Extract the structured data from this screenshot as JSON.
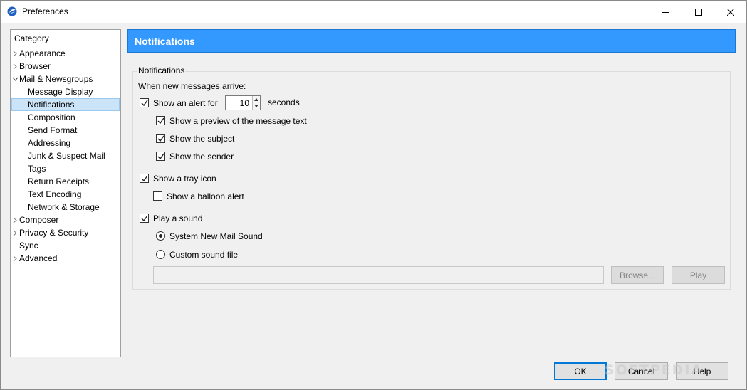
{
  "window": {
    "title": "Preferences"
  },
  "category": {
    "header": "Category",
    "items": [
      {
        "label": "Appearance"
      },
      {
        "label": "Browser"
      },
      {
        "label": "Mail & Newsgroups"
      },
      {
        "label": "Message Display"
      },
      {
        "label": "Notifications"
      },
      {
        "label": "Composition"
      },
      {
        "label": "Send Format"
      },
      {
        "label": "Addressing"
      },
      {
        "label": "Junk & Suspect Mail"
      },
      {
        "label": "Tags"
      },
      {
        "label": "Return Receipts"
      },
      {
        "label": "Text Encoding"
      },
      {
        "label": "Network & Storage"
      },
      {
        "label": "Composer"
      },
      {
        "label": "Privacy & Security"
      },
      {
        "label": "Sync"
      },
      {
        "label": "Advanced"
      }
    ]
  },
  "panel": {
    "title": "Notifications",
    "group_title": "Notifications",
    "intro": "When new messages arrive:",
    "alert_label": "Show an alert for",
    "alert_seconds": "10",
    "seconds_label": "seconds",
    "preview_label": "Show a preview of the message text",
    "subject_label": "Show the subject",
    "sender_label": "Show the sender",
    "tray_label": "Show a tray icon",
    "balloon_label": "Show a balloon alert",
    "sound_label": "Play a sound",
    "system_sound_label": "System New Mail Sound",
    "custom_sound_label": "Custom sound file",
    "browse_label": "Browse...",
    "play_label": "Play"
  },
  "states": {
    "show_alert": true,
    "show_preview": true,
    "show_subject": true,
    "show_sender": true,
    "show_tray": true,
    "show_balloon": false,
    "play_sound": true,
    "sound_choice": "system"
  },
  "footer": {
    "ok_label": "OK",
    "cancel_label": "Cancel",
    "help_label": "Help"
  },
  "watermark": "SOFTPEDIA",
  "colors": {
    "header_bg": "#3399ff",
    "selection_bg": "#cce4f7"
  }
}
